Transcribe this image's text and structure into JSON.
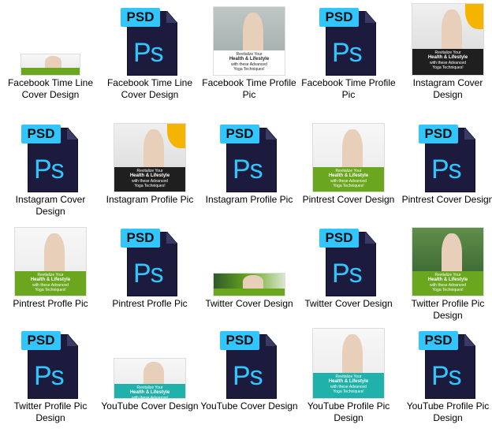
{
  "files": [
    {
      "label": "Facebook Time Line Cover Design",
      "kind": "image",
      "variant": "fb-cover"
    },
    {
      "label": "Facebook Time Line Cover Design",
      "kind": "psd"
    },
    {
      "label": "Facebook Time Profile Pic",
      "kind": "image",
      "variant": "fb-profile"
    },
    {
      "label": "Facebook Time Profile Pic",
      "kind": "psd"
    },
    {
      "label": "Instagram Cover Design",
      "kind": "image",
      "variant": "ig-cover"
    },
    {
      "label": "Instagram Cover Design",
      "kind": "psd"
    },
    {
      "label": "Instagram Profile Pic",
      "kind": "image",
      "variant": "ig-profile"
    },
    {
      "label": "Instagram Profile Pic",
      "kind": "psd"
    },
    {
      "label": "Pintrest Cover Design",
      "kind": "image",
      "variant": "pin-cover"
    },
    {
      "label": "Pintrest Cover Design",
      "kind": "psd"
    },
    {
      "label": "Pintrest Profle Pic",
      "kind": "image",
      "variant": "pin-profile"
    },
    {
      "label": "Pintrest Profle Pic",
      "kind": "psd"
    },
    {
      "label": "Twitter Cover Design",
      "kind": "image",
      "variant": "tw-cover"
    },
    {
      "label": "Twitter Cover Design",
      "kind": "psd"
    },
    {
      "label": "Twitter Profile Pic Design",
      "kind": "image",
      "variant": "tw-profile"
    },
    {
      "label": "Twitter Profile Pic Design",
      "kind": "psd"
    },
    {
      "label": "YouTube Cover Design",
      "kind": "image",
      "variant": "yt-cover"
    },
    {
      "label": "YouTube Cover Design",
      "kind": "psd"
    },
    {
      "label": "YouTube Profile Pic Design",
      "kind": "image",
      "variant": "yt-profile"
    },
    {
      "label": "YouTube Profile Pic Design",
      "kind": "psd"
    }
  ],
  "psd_icon": {
    "tag": "PSD",
    "glyph": "Ps",
    "accent": "#31c6ff",
    "body": "#1c1b3d"
  },
  "thumb_text": {
    "line1": "Revitalize Your",
    "line2": "Health & Lifestyle",
    "line3": "with these Advanced",
    "line4": "Yoga Techniques!"
  },
  "colors": {
    "green": "#6aa71f",
    "teal": "#20b2aa",
    "yellow": "#f4b400",
    "dark": "#222222"
  }
}
